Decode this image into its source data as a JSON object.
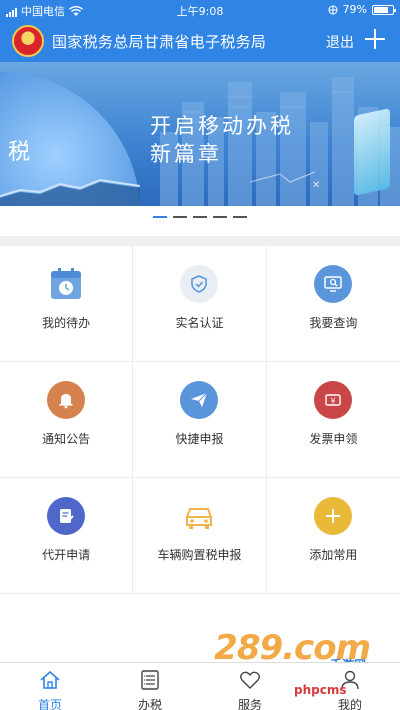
{
  "status_bar": {
    "carrier": "中国电信",
    "time": "上午9:08",
    "battery": "79%",
    "battery_level": 0.79
  },
  "header": {
    "title": "国家税务总局甘肃省电子税务局",
    "logout": "退出"
  },
  "banner": {
    "left_char": "税",
    "slogan_line1": "开启移动办税",
    "slogan_line2": "新篇章"
  },
  "pager": {
    "count": 5,
    "active_index": 0
  },
  "grid": [
    {
      "label": "我的待办",
      "icon": "calendar-clock-icon",
      "color": "#6ea4e0"
    },
    {
      "label": "实名认证",
      "icon": "shield-check-icon",
      "color": "#e9eef4"
    },
    {
      "label": "我要查询",
      "icon": "monitor-search-icon",
      "color": "#5b96dc"
    },
    {
      "label": "通知公告",
      "icon": "bell-icon",
      "color": "#d6824e"
    },
    {
      "label": "快捷申报",
      "icon": "paper-plane-icon",
      "color": "#5a95db"
    },
    {
      "label": "发票申领",
      "icon": "yen-ticket-icon",
      "color": "#c84646"
    },
    {
      "label": "代开申请",
      "icon": "document-edit-icon",
      "color": "#4f67c9"
    },
    {
      "label": "车辆购置税申报",
      "icon": "car-icon",
      "color": "#f2b54b"
    },
    {
      "label": "添加常用",
      "icon": "plus-circle-icon",
      "color": "#e9b93a"
    }
  ],
  "tabbar": [
    {
      "label": "首页",
      "icon": "home-icon",
      "active": true
    },
    {
      "label": "办税",
      "icon": "list-icon",
      "active": false
    },
    {
      "label": "服务",
      "icon": "heart-icon",
      "active": false
    },
    {
      "label": "我的",
      "icon": "person-icon",
      "active": false
    }
  ],
  "watermark": {
    "text": "289.com",
    "sub": "手游网",
    "site": "phpcms"
  }
}
